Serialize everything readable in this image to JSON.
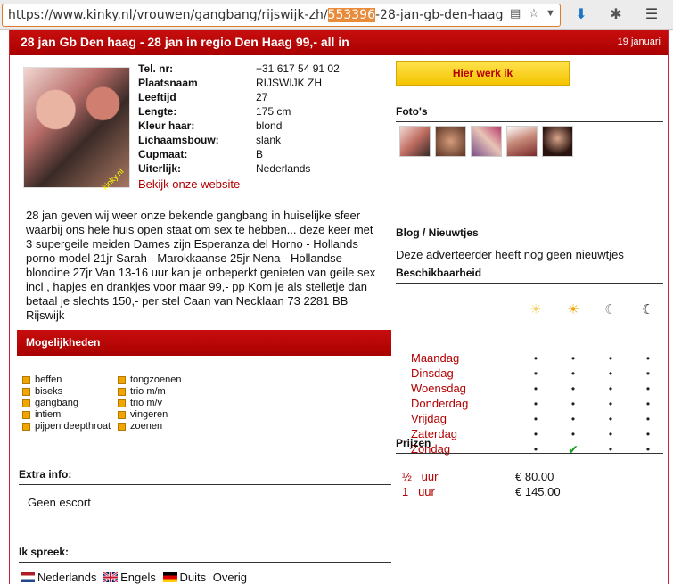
{
  "browser": {
    "url_prefix": "https://www.kinky.nl/vrouwen/gangbang/rijswijk-zh/",
    "url_highlight": "553396",
    "url_suffix": "-28-jan-gb-den-haag"
  },
  "listing": {
    "title": "28 jan Gb Den haag - 28 jan in regio Den Haag 99,- all in",
    "date": "19 januari",
    "photo_watermark": "kinky.nl"
  },
  "profile": {
    "rows": [
      {
        "key": "Tel. nr:",
        "value": "+31 617 54 91 02"
      },
      {
        "key": "Plaatsnaam",
        "value": "RIJSWIJK ZH"
      },
      {
        "key": "Leeftijd",
        "value": "27"
      },
      {
        "key": "Lengte:",
        "value": "175 cm"
      },
      {
        "key": "Kleur haar:",
        "value": "blond"
      },
      {
        "key": "Lichaamsbouw:",
        "value": "slank"
      },
      {
        "key": "Cupmaat:",
        "value": "B"
      },
      {
        "key": "Uiterlijk:",
        "value": "Nederlands"
      }
    ],
    "website_link": "Bekijk onze website"
  },
  "description": "28 jan geven wij weer onze bekende gangbang in huiselijke sfeer waarbij ons hele huis open staat om sex te hebben... deze keer met 3 supergeile meiden Dames zijn Esperanza del Horno - Hollands porno model 21jr Sarah - Marokkaanse 25jr Nena - Hollandse blondine 27jr Van 13-16 uur kan je onbeperkt genieten van geile sex incl , hapjes en drankjes voor maar 99,- pp Kom je als stelletje dan betaal je slechts 150,- per stel Caan van Necklaan 73 2281 BB Rijswijk",
  "possibilities": {
    "heading": "Mogelijkheden",
    "col1": [
      "beffen",
      "biseks",
      "gangbang",
      "intiem",
      "pijpen deepthroat"
    ],
    "col2": [
      "tongzoenen",
      "trio m/m",
      "trio m/v",
      "vingeren",
      "zoenen"
    ]
  },
  "extra_info": {
    "label": "Extra info:",
    "value": "Geen escort"
  },
  "languages": {
    "label": "Ik spreek:",
    "items": [
      "Nederlands",
      "Engels",
      "Duits",
      "Overig"
    ]
  },
  "sidebar": {
    "work_button": "Hier werk ik",
    "photos_label": "Foto's",
    "blog_label": "Blog / Nieuwtjes",
    "blog_text": "Deze adverteerder heeft nog geen nieuwtjes",
    "availability_label": "Beschikbaarheid",
    "days": [
      "Maandag",
      "Dinsdag",
      "Woensdag",
      "Donderdag",
      "Vrijdag",
      "Zaterdag",
      "Zondag"
    ],
    "dot": "•",
    "check": "✔",
    "available": [
      {
        "day": 6,
        "slot": 1
      }
    ],
    "prices_label": "Prijzen",
    "prices": [
      {
        "unit": "½   uur",
        "amount": "€ 80.00"
      },
      {
        "unit": "1   uur",
        "amount": "€ 145.00"
      }
    ]
  },
  "colors": {
    "brand_red": "#b80000",
    "button_yellow": "#f4c400",
    "check_green": "#1a9a1a"
  }
}
